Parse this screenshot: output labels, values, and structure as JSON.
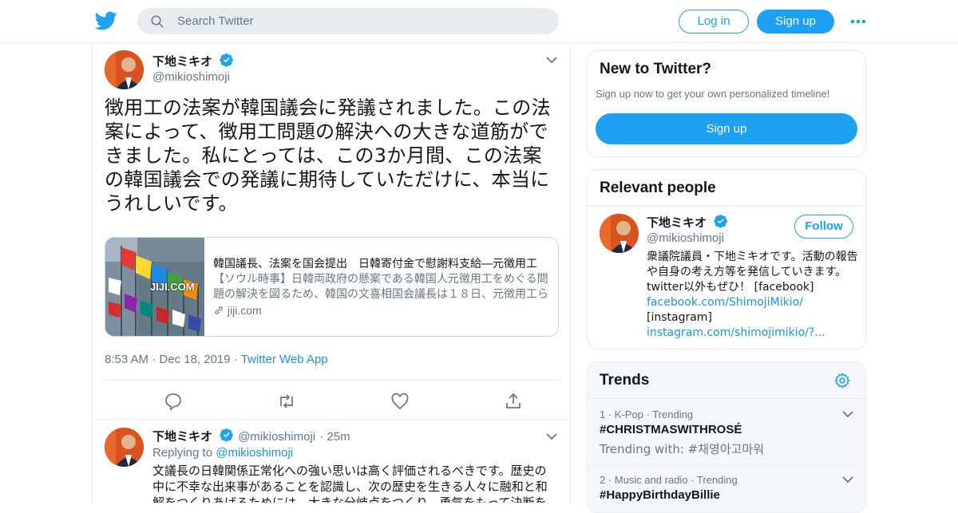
{
  "header": {
    "search_placeholder": "Search Twitter",
    "login_label": "Log in",
    "signup_label": "Sign up"
  },
  "tweet": {
    "author_name": "下地ミキオ",
    "author_handle": "@mikioshimoji",
    "text": "徴用工の法案が韓国議会に発議されました。この法案によって、徴用工問題の解決への大きな道筋ができました。私にとっては、この3か月間、この法案の韓国議会での発議に期待していただけに、本当にうれしいです。",
    "card": {
      "title": "韓国議長、法案を国会提出　日韓寄付金で慰謝料支給―元徴用工",
      "description": "【ソウル時事】日韓両政府の懸案である韓国人元徴用工をめぐる問題の解決を図るため、韓国の文喜相国会議長は１８日、元徴用工らに慰謝料を支給する財団を設立する法案を国会に提出した。",
      "domain": "jiji.com",
      "image_watermark": "JIJI.COM"
    },
    "time": "8:53 AM",
    "date": "Dec 18, 2019",
    "source": "Twitter Web App"
  },
  "reply": {
    "author_name": "下地ミキオ",
    "author_handle": "@mikioshimoji",
    "age": "25m",
    "replying_prefix": "Replying to",
    "replying_to": "@mikioshimoji",
    "text": "文議長の日韓関係正常化への強い思いは高く評価されるべきです。歴史の中に不幸な出来事があることを認識し、次の歴史を生きる人々に融和と和解をつくりあげるためには、大きな分岐点をつくり、勇気をもって決断を"
  },
  "new_to_twitter": {
    "title": "New to Twitter?",
    "subtitle": "Sign up now to get your own personalized timeline!",
    "signup_label": "Sign up"
  },
  "relevant_people": {
    "title": "Relevant people",
    "name": "下地ミキオ",
    "handle": "@mikioshimoji",
    "follow_label": "Follow",
    "bio_text": "衆議院議員・下地ミキオです。活動の報告や自身の考え方等を発信していきます。 twitter以外もぜひ！ [facebook]",
    "bio_link1": "facebook.com/ShimojiMikio/",
    "bio_text2": "[instagram]",
    "bio_link2": "instagram.com/shimojimikio/?..."
  },
  "trends": {
    "title": "Trends",
    "items": [
      {
        "meta": "1 · K-Pop · Trending",
        "name": "#CHRISTMASWITHROSÉ",
        "with": "Trending with: #채영아고마워"
      },
      {
        "meta": "2 · Music and radio · Trending",
        "name": "#HappyBirthdayBillie",
        "with": ""
      }
    ]
  },
  "colors": {
    "accent": "#1da1f2",
    "link": "#1b95e0",
    "muted": "#657786",
    "border": "#e6ecf0"
  }
}
